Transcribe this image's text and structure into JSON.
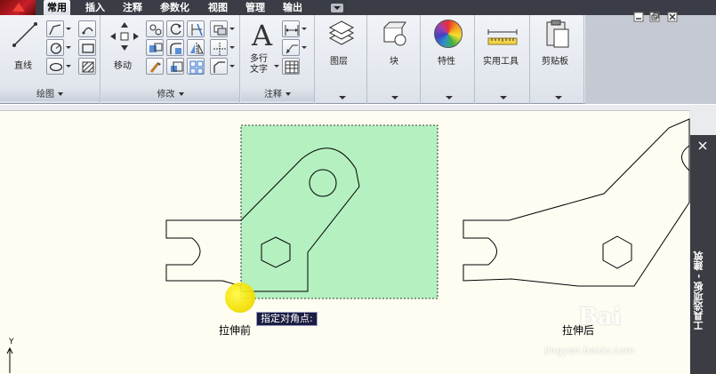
{
  "menu_tabs": [
    {
      "label": "常用",
      "active": true
    },
    {
      "label": "插入",
      "active": false
    },
    {
      "label": "注释",
      "active": false
    },
    {
      "label": "参数化",
      "active": false
    },
    {
      "label": "视图",
      "active": false
    },
    {
      "label": "管理",
      "active": false
    },
    {
      "label": "输出",
      "active": false
    }
  ],
  "ribbon": {
    "draw": {
      "title": "绘图",
      "line_label": "直线"
    },
    "modify": {
      "title": "修改",
      "move_label": "移动"
    },
    "annotation": {
      "title": "注释",
      "mtext_label": "多行\n文字"
    },
    "layers_label": "图层",
    "block_label": "块",
    "properties_label": "特性",
    "utilities_label": "实用工具",
    "clipboard_label": "剪贴板"
  },
  "canvas": {
    "label_before": "拉伸前",
    "label_after": "拉伸后",
    "tooltip": "指定对角点:",
    "ucs_y": "Y"
  },
  "tool_palette": {
    "title": "工具选项板 - 建筑"
  },
  "watermark": {
    "line1": "Bai",
    "line2": "jingyan.baidu.com"
  },
  "colors": {
    "selection_fill": "#b4f0c0",
    "cursor": "#f4df00",
    "tooltip_bg": "#1b1d40"
  }
}
